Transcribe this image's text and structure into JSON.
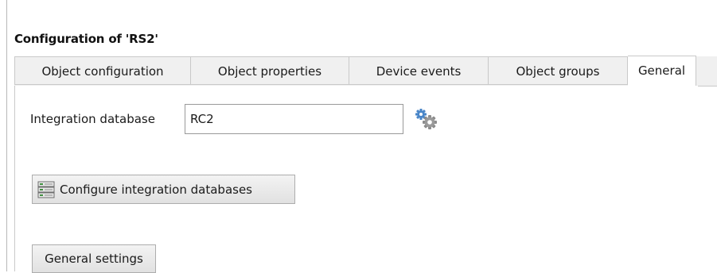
{
  "window": {
    "title": "Configuration of 'RS2'"
  },
  "tabs": [
    {
      "label": "Object configuration",
      "active": false
    },
    {
      "label": "Object properties",
      "active": false
    },
    {
      "label": "Device events",
      "active": false
    },
    {
      "label": "Object groups",
      "active": false
    },
    {
      "label": "General",
      "active": true
    }
  ],
  "general": {
    "integration_database_label": "Integration database",
    "integration_database_value": "RC2",
    "gear_icon": "gear-icon",
    "configure_button_label": "Configure integration databases",
    "configure_button_icon": "database-icon",
    "general_settings_label": "General settings"
  },
  "colors": {
    "tab_background": "#f0f0f0",
    "active_tab_background": "#ffffff",
    "border": "#c9c9c9",
    "gear_blue": "#4a86c8",
    "gear_gray": "#8c8c8c"
  }
}
